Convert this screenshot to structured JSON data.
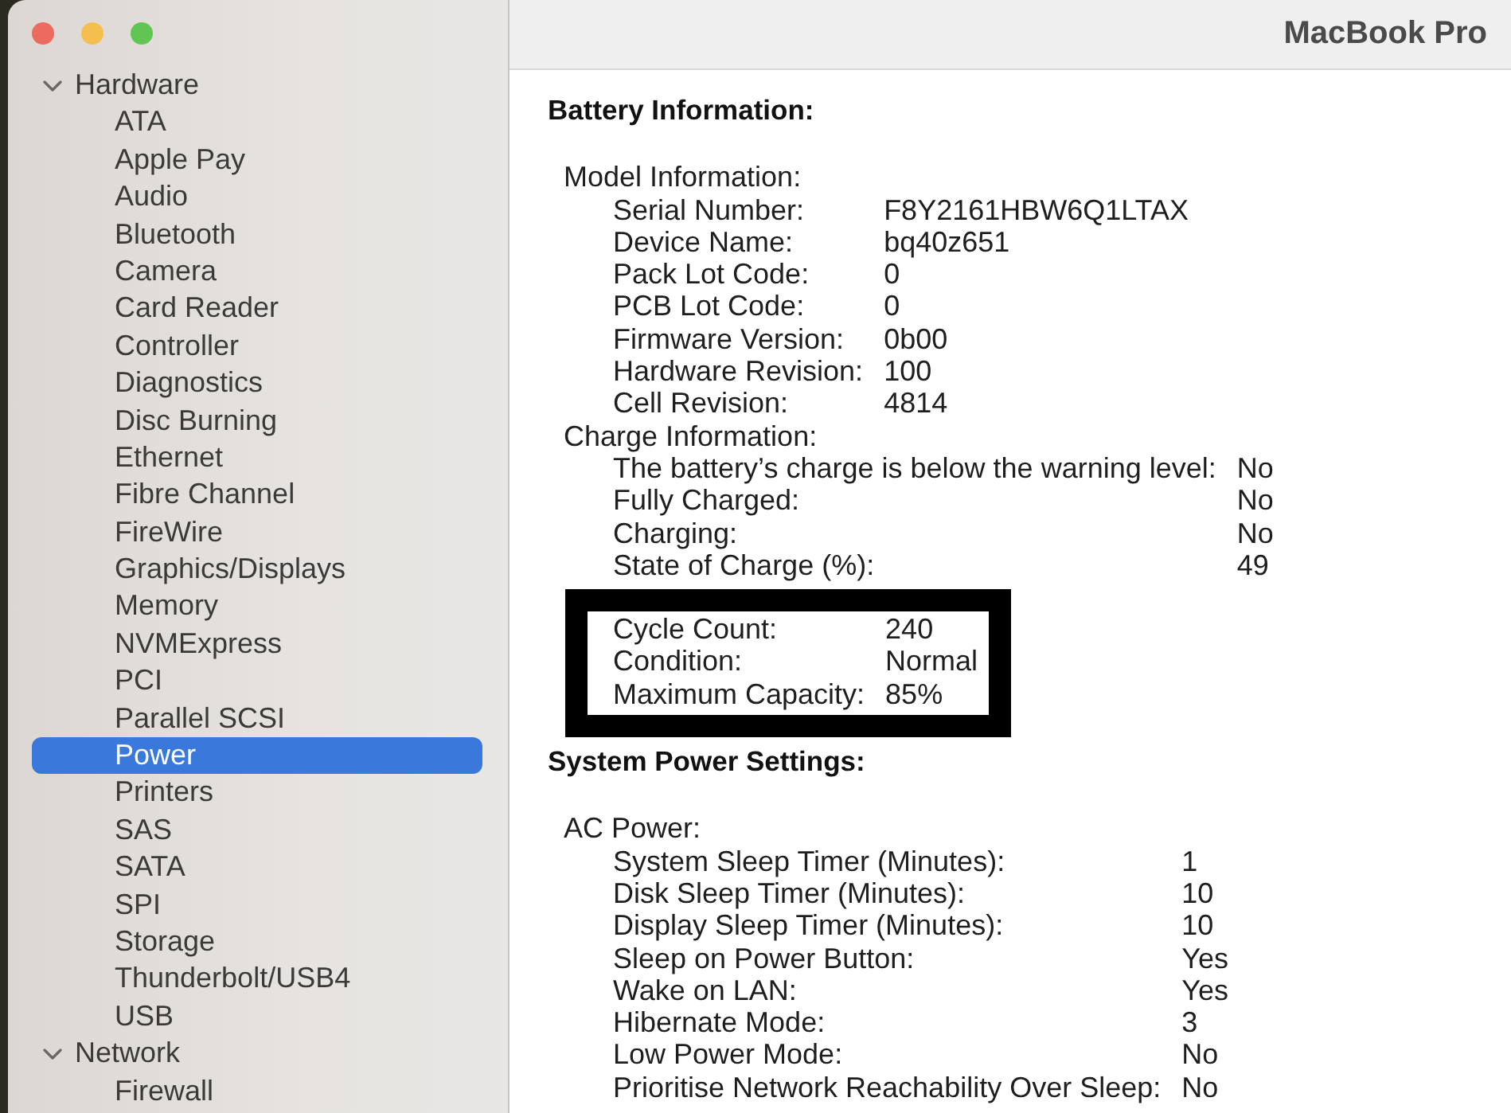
{
  "window": {
    "title": "MacBook Pro"
  },
  "sidebar": {
    "groups": [
      {
        "label": "Hardware",
        "expanded": true,
        "children": [
          {
            "label": "ATA",
            "selected": false
          },
          {
            "label": "Apple Pay",
            "selected": false
          },
          {
            "label": "Audio",
            "selected": false
          },
          {
            "label": "Bluetooth",
            "selected": false
          },
          {
            "label": "Camera",
            "selected": false
          },
          {
            "label": "Card Reader",
            "selected": false
          },
          {
            "label": "Controller",
            "selected": false
          },
          {
            "label": "Diagnostics",
            "selected": false
          },
          {
            "label": "Disc Burning",
            "selected": false
          },
          {
            "label": "Ethernet",
            "selected": false
          },
          {
            "label": "Fibre Channel",
            "selected": false
          },
          {
            "label": "FireWire",
            "selected": false
          },
          {
            "label": "Graphics/Displays",
            "selected": false
          },
          {
            "label": "Memory",
            "selected": false
          },
          {
            "label": "NVMExpress",
            "selected": false
          },
          {
            "label": "PCI",
            "selected": false
          },
          {
            "label": "Parallel SCSI",
            "selected": false
          },
          {
            "label": "Power",
            "selected": true
          },
          {
            "label": "Printers",
            "selected": false
          },
          {
            "label": "SAS",
            "selected": false
          },
          {
            "label": "SATA",
            "selected": false
          },
          {
            "label": "SPI",
            "selected": false
          },
          {
            "label": "Storage",
            "selected": false
          },
          {
            "label": "Thunderbolt/USB4",
            "selected": false
          },
          {
            "label": "USB",
            "selected": false
          }
        ]
      },
      {
        "label": "Network",
        "expanded": true,
        "children": [
          {
            "label": "Firewall",
            "selected": false
          }
        ]
      }
    ]
  },
  "content": {
    "sections": [
      {
        "title": "Battery Information:",
        "groups": [
          {
            "title": "Model Information:",
            "highlighted": false,
            "rows": [
              {
                "label": "Serial Number:",
                "value": "F8Y2161HBW6Q1LTAX"
              },
              {
                "label": "Device Name:",
                "value": "bq40z651"
              },
              {
                "label": "Pack Lot Code:",
                "value": "0"
              },
              {
                "label": "PCB Lot Code:",
                "value": "0"
              },
              {
                "label": "Firmware Version:",
                "value": "0b00"
              },
              {
                "label": "Hardware Revision:",
                "value": "100"
              },
              {
                "label": "Cell Revision:",
                "value": "4814"
              }
            ]
          },
          {
            "title": "Charge Information:",
            "highlighted": false,
            "rows": [
              {
                "label": "The battery’s charge is below the warning level:",
                "value": "No"
              },
              {
                "label": "Fully Charged:",
                "value": "No"
              },
              {
                "label": "Charging:",
                "value": "No"
              },
              {
                "label": "State of Charge (%):",
                "value": "49"
              }
            ]
          },
          {
            "highlighted": true,
            "rows": [
              {
                "label": "Cycle Count:",
                "value": "240"
              },
              {
                "label": "Condition:",
                "value": "Normal"
              },
              {
                "label": "Maximum Capacity:",
                "value": "85%"
              }
            ]
          }
        ]
      },
      {
        "title": "System Power Settings:",
        "groups": [
          {
            "title": "AC Power:",
            "highlighted": false,
            "rows": [
              {
                "label": "System Sleep Timer (Minutes):",
                "value": "1"
              },
              {
                "label": "Disk Sleep Timer (Minutes):",
                "value": "10"
              },
              {
                "label": "Display Sleep Timer (Minutes):",
                "value": "10"
              },
              {
                "label": "Sleep on Power Button:",
                "value": "Yes"
              },
              {
                "label": "Wake on LAN:",
                "value": "Yes"
              },
              {
                "label": "Hibernate Mode:",
                "value": "3"
              },
              {
                "label": "Low Power Mode:",
                "value": "No"
              },
              {
                "label": "Prioritise Network Reachability Over Sleep:",
                "value": "No"
              }
            ]
          }
        ]
      }
    ]
  }
}
